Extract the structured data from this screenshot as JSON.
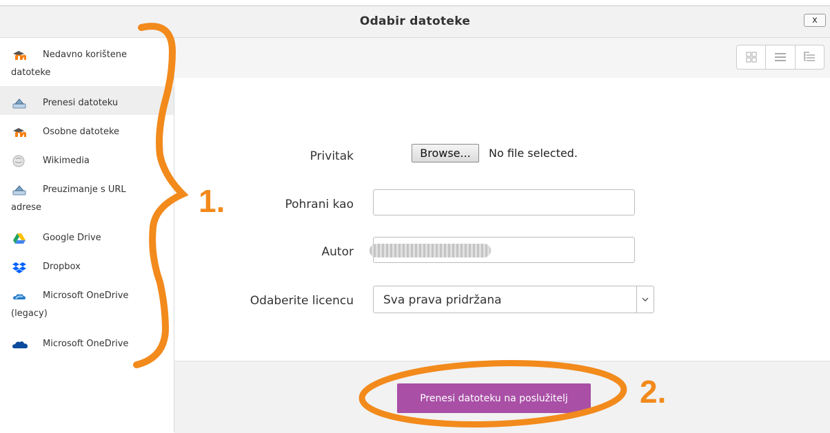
{
  "dialog": {
    "title": "Odabir datoteke",
    "close_label": "x"
  },
  "sidebar": {
    "items": [
      {
        "first": "Nedavno korištene",
        "rest": "datoteke",
        "icon": "moodle-icon"
      },
      {
        "first": "Prenesi datoteku",
        "rest": "",
        "icon": "upload-icon"
      },
      {
        "first": "Osobne datoteke",
        "rest": "",
        "icon": "moodle-icon"
      },
      {
        "first": "Wikimedia",
        "rest": "",
        "icon": "wikimedia-icon"
      },
      {
        "first": "Preuzimanje s URL",
        "rest": "adrese",
        "icon": "url-download-icon"
      },
      {
        "first": "Google Drive",
        "rest": "",
        "icon": "google-drive-icon"
      },
      {
        "first": "Dropbox",
        "rest": "",
        "icon": "dropbox-icon"
      },
      {
        "first": "Microsoft OneDrive",
        "rest": "(legacy)",
        "icon": "onedrive-legacy-icon"
      },
      {
        "first": "Microsoft OneDrive",
        "rest": "",
        "icon": "onedrive-icon"
      }
    ]
  },
  "form": {
    "attachment_label": "Privitak",
    "browse_label": "Browse...",
    "no_file_text": "No file selected.",
    "save_as_label": "Pohrani kao",
    "save_as_value": "",
    "author_label": "Autor",
    "license_label": "Odaberite licencu",
    "license_value": "Sva prava pridržana"
  },
  "footer": {
    "upload_label": "Prenesi datoteku na poslužitelj"
  },
  "annotations": {
    "marker_1": "1.",
    "marker_2": "2."
  },
  "colors": {
    "accent_purple": "#a94fa6",
    "annotation_orange": "#f28a1c"
  }
}
